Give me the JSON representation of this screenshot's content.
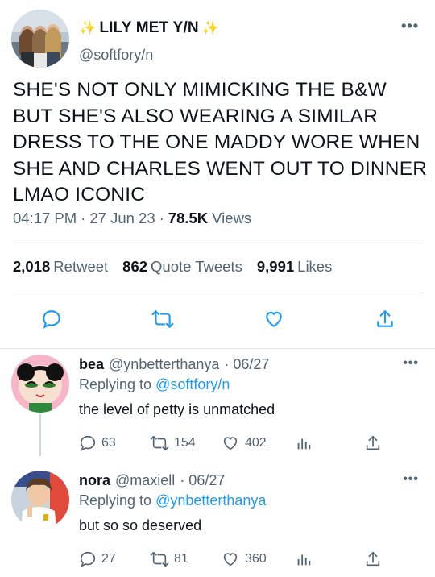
{
  "main_tweet": {
    "display_name": "LILY MET Y/N",
    "sparkle_left": "✨",
    "sparkle_right": "✨",
    "handle": "@softfory/n",
    "text": "SHE'S NOT ONLY MIMICKING THE B&W BUT SHE'S ALSO WEARING A SIMILAR DRESS TO THE ONE MADDY WORE WHEN SHE AND CHARLES WENT OUT TO DINNER LMAO ICONIC",
    "time": "04:17 PM",
    "date": "27 Jun 23",
    "views_count": "78.5K",
    "views_label": "Views",
    "sep": "·",
    "retweets_count": "2,018",
    "retweets_label": "Retweet",
    "quotes_count": "862",
    "quotes_label": "Quote Tweets",
    "likes_count": "9,991",
    "likes_label": "Likes"
  },
  "replies": [
    {
      "name": "bea",
      "handle": "@ynbetterthanya",
      "date": "· 06/27",
      "replying_prefix": "Replying to",
      "replying_to": "@softfory/n",
      "text": "the level of petty is unmatched",
      "replies": "63",
      "retweets": "154",
      "likes": "402"
    },
    {
      "name": "nora",
      "handle": "@maxiell",
      "date": "· 06/27",
      "replying_prefix": "Replying to",
      "replying_to": "@ynbetterthanya",
      "text": "but so so deserved",
      "replies": "27",
      "retweets": "81",
      "likes": "360"
    }
  ],
  "more_label": "•••",
  "colors": {
    "accent": "#1d9bf0",
    "muted": "#536471",
    "divider": "#e1e6ea"
  }
}
